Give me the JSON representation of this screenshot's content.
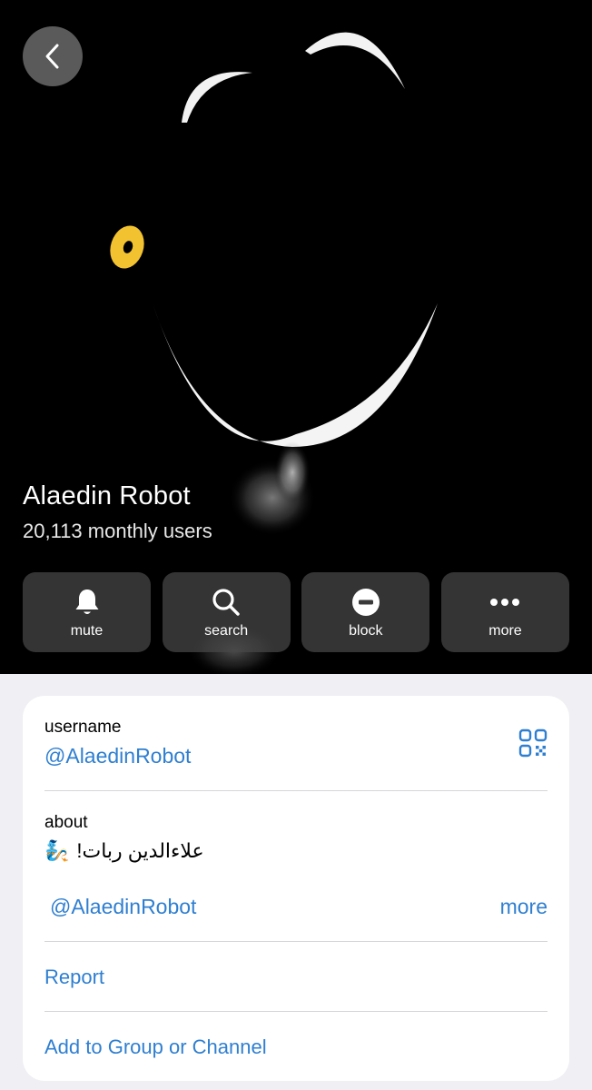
{
  "header": {
    "name": "Alaedin Robot",
    "subtitle": "20,113 monthly users"
  },
  "actions": [
    {
      "label": "mute",
      "icon": "bell-icon"
    },
    {
      "label": "search",
      "icon": "search-icon"
    },
    {
      "label": "block",
      "icon": "block-icon"
    },
    {
      "label": "more",
      "icon": "more-dots-icon"
    }
  ],
  "info": {
    "username_label": "username",
    "username_value": "@AlaedinRobot",
    "about_label": "about",
    "about_text": "علاءالدین ربات!",
    "about_emoji": "🧞",
    "about_link": "@AlaedinRobot",
    "more_label": "more",
    "report_label": "Report",
    "add_label": "Add to Group or Channel"
  },
  "colors": {
    "accent": "#2f7fd1",
    "hero_bg": "#000000",
    "eye": "#f2c230"
  }
}
